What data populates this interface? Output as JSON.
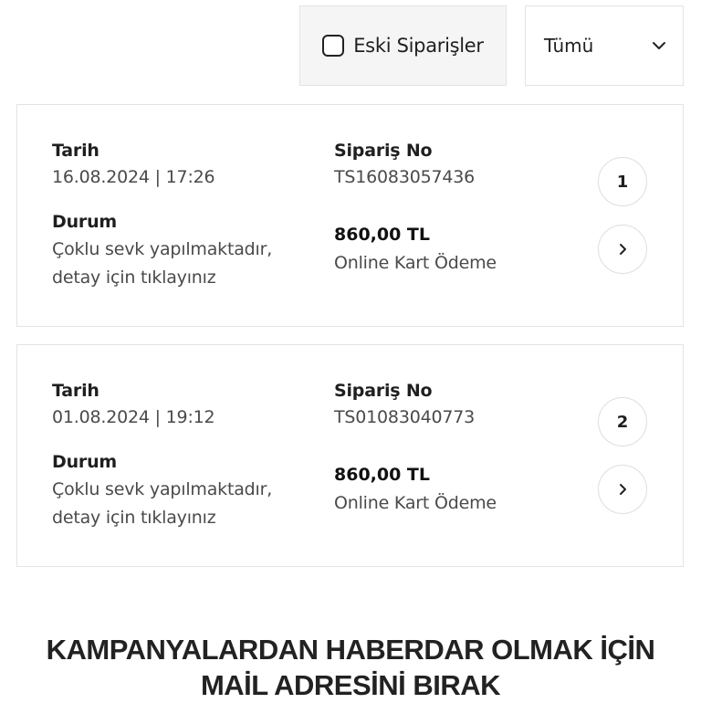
{
  "filters": {
    "old_orders_label": "Eski Siparişler",
    "old_orders_checked": false,
    "status_select_value": "Tümü"
  },
  "orders": [
    {
      "index": "1",
      "date_label": "Tarih",
      "date_value": "16.08.2024 | 17:26",
      "order_no_label": "Sipariş No",
      "order_no_value": "TS16083057436",
      "status_label": "Durum",
      "status_line1": "Çoklu sevk yapılmaktadır,",
      "status_line2": "detay için tıklayınız",
      "amount": "860,00 TL",
      "payment_method": "Online Kart Ödeme"
    },
    {
      "index": "2",
      "date_label": "Tarih",
      "date_value": "01.08.2024 | 19:12",
      "order_no_label": "Sipariş No",
      "order_no_value": "TS01083040773",
      "status_label": "Durum",
      "status_line1": "Çoklu sevk yapılmaktadır,",
      "status_line2": "detay için tıklayınız",
      "amount": "860,00 TL",
      "payment_method": "Online Kart Ödeme"
    }
  ],
  "newsletter": {
    "title_line1": "KAMPANYALARDAN HABERDAR OLMAK İÇİN",
    "title_line2": "MAİL ADRESİNİ BIRAK"
  }
}
